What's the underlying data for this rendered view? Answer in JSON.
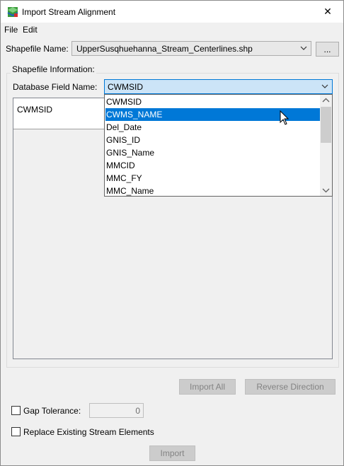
{
  "window": {
    "title": "Import Stream Alignment",
    "close_glyph": "✕"
  },
  "menu": {
    "file": "File",
    "edit": "Edit"
  },
  "shapefile": {
    "label": "Shapefile Name:",
    "value": "UpperSusqhuehanna_Stream_Centerlines.shp",
    "browse_label": "..."
  },
  "info_group": {
    "title": "Shapefile Information:",
    "db_field_label": "Database Field Name:",
    "db_field_value": "CWMSID",
    "column_header": "CWMSID"
  },
  "dropdown": {
    "items": [
      "CWMSID",
      "CWMS_NAME",
      "Del_Date",
      "GNIS_ID",
      "GNIS_Name",
      "MMCID",
      "MMC_FY",
      "MMC_Name"
    ],
    "selected": "CWMS_NAME"
  },
  "actions": {
    "import_all": "Import All",
    "reverse_direction": "Reverse Direction"
  },
  "gap": {
    "label": "Gap Tolerance:",
    "value": "0",
    "checked": false
  },
  "replace": {
    "label": "Replace Existing Stream Elements",
    "checked": false
  },
  "import_button": "Import",
  "colors": {
    "selection": "#0078d7",
    "disabled_text": "#838383"
  },
  "icons": [
    "app-icon",
    "close-icon",
    "chevron-down-icon",
    "mouse-cursor-icon",
    "scroll-up-icon",
    "scroll-down-icon"
  ]
}
